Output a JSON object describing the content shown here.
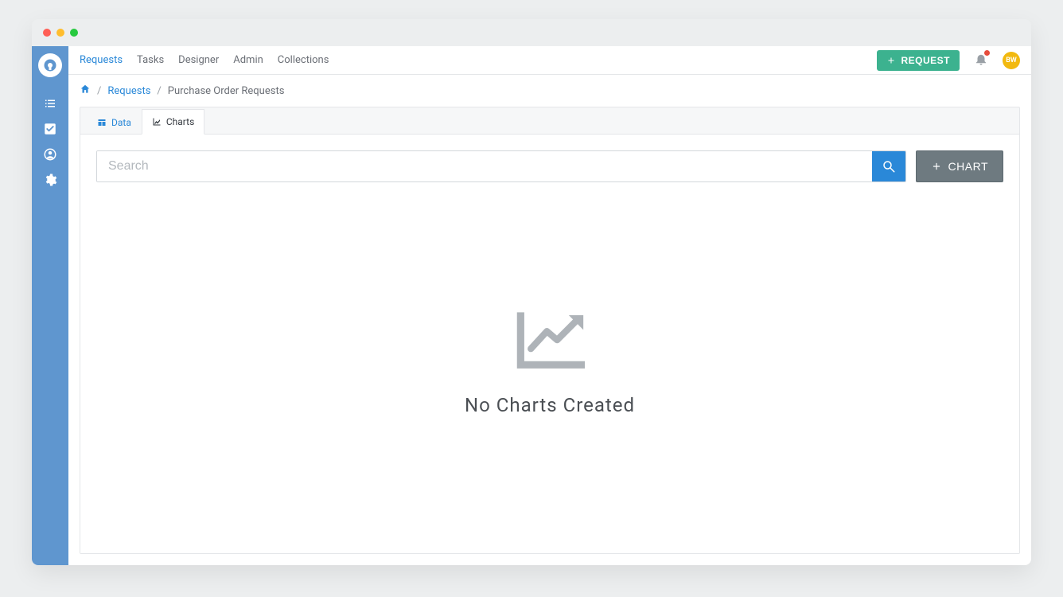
{
  "nav": {
    "items": [
      {
        "label": "Requests",
        "active": true
      },
      {
        "label": "Tasks",
        "active": false
      },
      {
        "label": "Designer",
        "active": false
      },
      {
        "label": "Admin",
        "active": false
      },
      {
        "label": "Collections",
        "active": false
      }
    ],
    "request_button_label": "REQUEST"
  },
  "avatar": {
    "initials": "BW"
  },
  "breadcrumb": {
    "link_label": "Requests",
    "current_label": "Purchase Order Requests"
  },
  "tabs": {
    "data_label": "Data",
    "charts_label": "Charts"
  },
  "search": {
    "placeholder": "Search"
  },
  "buttons": {
    "chart_label": "CHART"
  },
  "empty_state": {
    "title": "No Charts Created"
  },
  "sidebar": {
    "icons": [
      "list-icon",
      "checkbox-icon",
      "user-circle-icon",
      "gear-icon"
    ]
  }
}
